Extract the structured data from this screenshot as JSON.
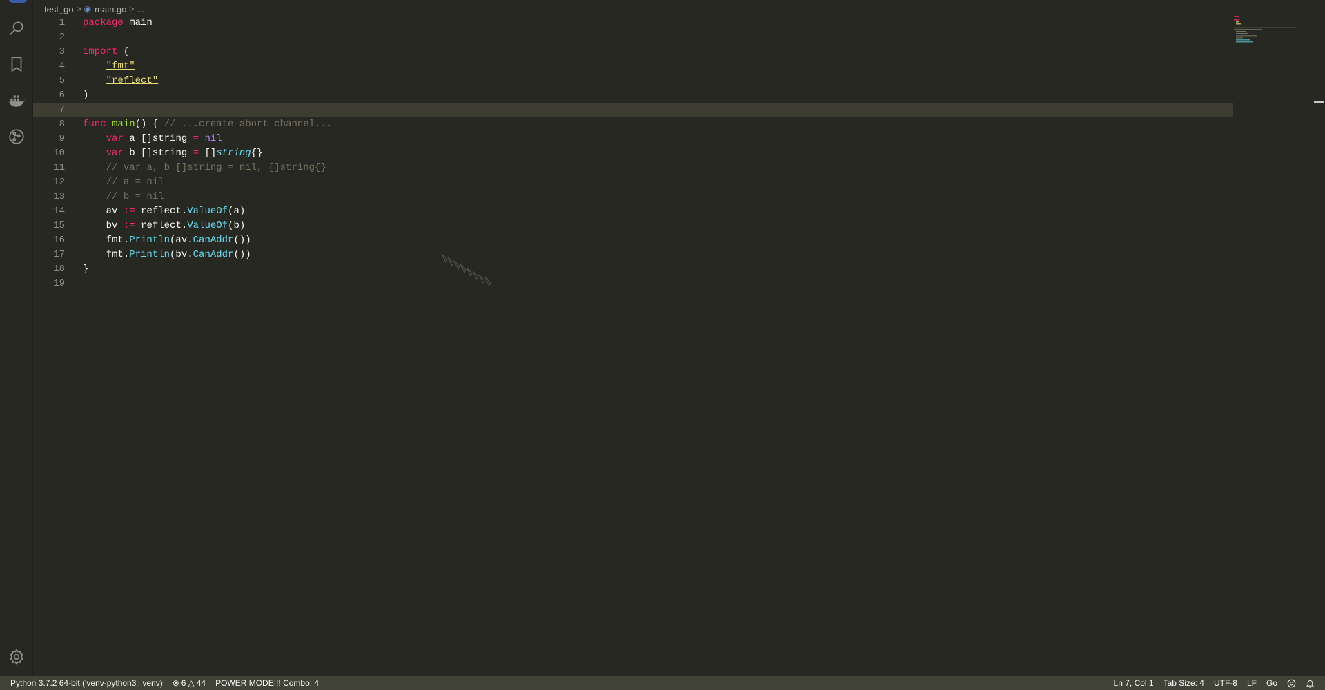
{
  "breadcrumb": {
    "folder": "test_go",
    "file": "main.go",
    "more": "..."
  },
  "code": {
    "lines": [
      {
        "n": "1"
      },
      {
        "n": "2"
      },
      {
        "n": "3"
      },
      {
        "n": "4"
      },
      {
        "n": "5"
      },
      {
        "n": "6"
      },
      {
        "n": "7"
      },
      {
        "n": "8"
      },
      {
        "n": "9"
      },
      {
        "n": "10"
      },
      {
        "n": "11"
      },
      {
        "n": "12"
      },
      {
        "n": "13"
      },
      {
        "n": "14"
      },
      {
        "n": "15"
      },
      {
        "n": "16"
      },
      {
        "n": "17"
      },
      {
        "n": "18"
      },
      {
        "n": "19"
      }
    ],
    "current_line": 7,
    "tokens": {
      "l1_kw": "package",
      "l1_name": " main",
      "l3_kw": "import",
      "l3_rest": " (",
      "l4_str": "\"fmt\"",
      "l5_str": "\"reflect\"",
      "l6": ")",
      "l8_kw": "func",
      "l8_fn": "main",
      "l8_rest": "() { ",
      "l8_cm": "// ...create abort channel...",
      "l9_kw": "var",
      "l9_rest": " a []string ",
      "l9_op": "=",
      "l9_nil": "nil",
      "l10_kw": "var",
      "l10_rest": " b []string ",
      "l10_op": "=",
      "l10_br": " []",
      "l10_ty": "string",
      "l10_end": "{}",
      "l11_cm": "// var a, b []string = nil, []string{}",
      "l12_cm": "// a = nil",
      "l13_cm": "// b = nil",
      "l14_a": "av ",
      "l14_op": ":=",
      "l14_b": " reflect.",
      "l14_m": "ValueOf",
      "l14_c": "(a)",
      "l15_a": "bv ",
      "l15_op": ":=",
      "l15_b": " reflect.",
      "l15_m": "ValueOf",
      "l15_c": "(b)",
      "l16_a": "fmt.",
      "l16_m": "Println",
      "l16_b": "(av.",
      "l16_m2": "CanAddr",
      "l16_c": "())",
      "l17_a": "fmt.",
      "l17_m": "Println",
      "l17_b": "(bv.",
      "l17_m2": "CanAddr",
      "l17_c": "())",
      "l18": "}"
    }
  },
  "activity_bar": {
    "icons": [
      "search-icon",
      "bookmark-icon",
      "docker-icon",
      "git-graph-icon",
      "settings-gear-icon"
    ]
  },
  "status_bar": {
    "python_interpreter": "Python 3.7.2 64-bit ('venv-python3': venv)",
    "errors": "6",
    "warnings": "44",
    "power_mode": "POWER MODE!!! Combo: 4",
    "cursor_position": "Ln 7, Col 1",
    "tab_size": "Tab Size: 4",
    "encoding": "UTF-8",
    "line_ending": "LF",
    "language": "Go"
  },
  "colors": {
    "editor_bg": "#272822",
    "current_line": "#3e3d32",
    "keyword": "#f92672",
    "string": "#e6db74",
    "function": "#a6e22e",
    "type": "#66d9ef",
    "comment": "#75715e",
    "constant": "#ae81ff",
    "status_bar_bg": "#414339"
  }
}
